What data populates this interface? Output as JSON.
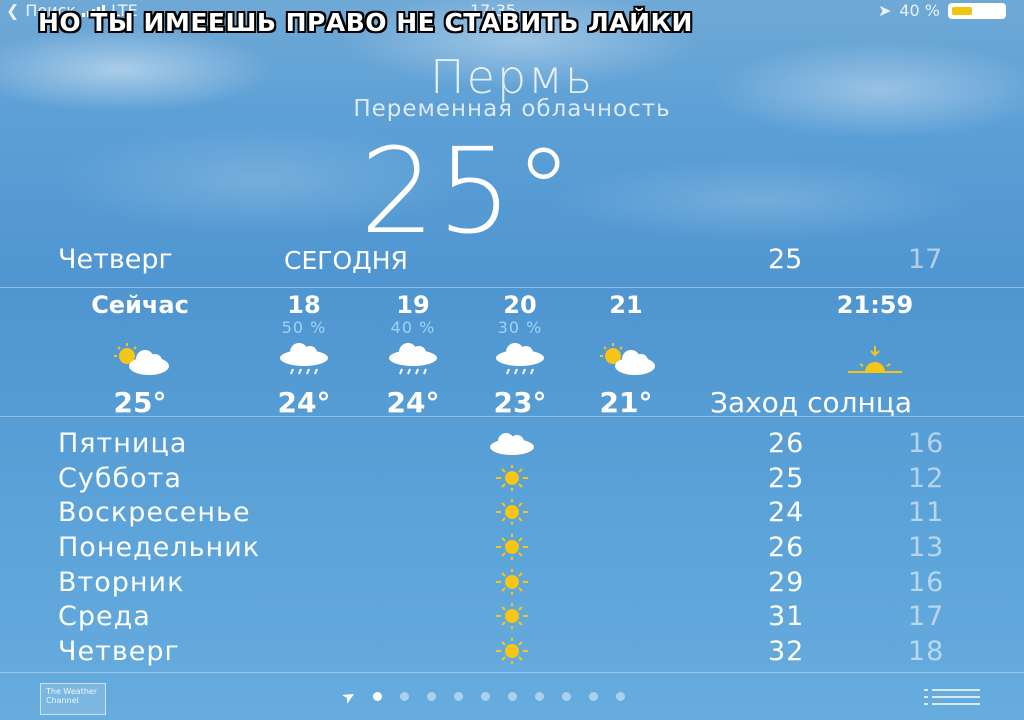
{
  "statusbar": {
    "back_label": "Поиск",
    "network": "LTE",
    "time": "17:35",
    "battery_text": "40 %",
    "battery_level": 0.4
  },
  "caption": "НО ТЫ ИМЕЕШЬ ПРАВО НЕ СТАВИТЬ ЛАЙКИ",
  "header": {
    "city": "Пермь",
    "condition": "Переменная облачность",
    "temperature": "25°"
  },
  "today": {
    "day": "Четверг",
    "label": "СЕГОДНЯ",
    "high": "25",
    "low": "17"
  },
  "hourly": [
    {
      "time": "Сейчас",
      "precip": "",
      "icon": "partly-cloudy-icon",
      "temp": "25°"
    },
    {
      "time": "18",
      "precip": "50 %",
      "icon": "rain-cloud-icon",
      "temp": "24°"
    },
    {
      "time": "19",
      "precip": "40 %",
      "icon": "rain-cloud-icon",
      "temp": "24°"
    },
    {
      "time": "20",
      "precip": "30 %",
      "icon": "rain-cloud-icon",
      "temp": "23°"
    },
    {
      "time": "21",
      "precip": "",
      "icon": "partly-cloudy-icon",
      "temp": "21°"
    },
    {
      "time": "21:59",
      "precip": "",
      "icon": "sunset-icon",
      "temp": "Заход солнца"
    }
  ],
  "daily": [
    {
      "day": "Пятница",
      "icon": "cloud-icon",
      "high": "26",
      "low": "16"
    },
    {
      "day": "Суббота",
      "icon": "sun-icon",
      "high": "25",
      "low": "12"
    },
    {
      "day": "Воскресенье",
      "icon": "sun-icon",
      "high": "24",
      "low": "11"
    },
    {
      "day": "Понедельник",
      "icon": "sun-icon",
      "high": "26",
      "low": "13"
    },
    {
      "day": "Вторник",
      "icon": "sun-icon",
      "high": "29",
      "low": "16"
    },
    {
      "day": "Среда",
      "icon": "sun-icon",
      "high": "31",
      "low": "17"
    },
    {
      "day": "Четверг",
      "icon": "sun-icon",
      "high": "32",
      "low": "18"
    }
  ],
  "footer": {
    "provider": "The Weather Channel",
    "page_count": 10,
    "active_page": 1
  },
  "colors": {
    "precip": "#9fd3f5",
    "sun": "#f5c518",
    "battery": "#f1c40f"
  }
}
